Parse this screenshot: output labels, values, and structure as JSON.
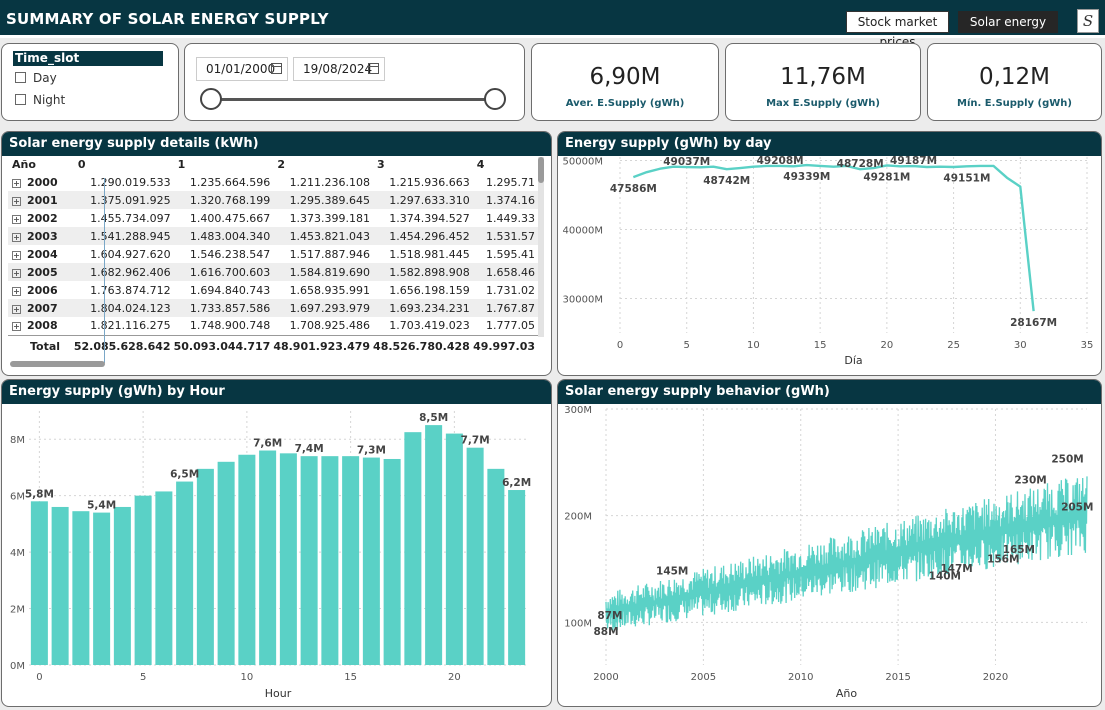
{
  "header": {
    "title": "SUMMARY OF SOLAR ENERGY SUPPLY",
    "nav_stock": "Stock market prices",
    "nav_solar": "Solar energy",
    "logo_glyph": "S"
  },
  "colors": {
    "header_bg": "#073642",
    "bar": "#5ad1c6",
    "line": "#5ad1c6"
  },
  "slicer": {
    "title": "Time_slot",
    "options": [
      "Day",
      "Night"
    ]
  },
  "date_range": {
    "start": "01/01/2000",
    "end": "19/08/2024",
    "slider_low": 0,
    "slider_high": 1
  },
  "kpis": [
    {
      "value": "6,90M",
      "label": "Aver. E.Supply (gWh)"
    },
    {
      "value": "11,76M",
      "label": "Max E.Supply (gWh)"
    },
    {
      "value": "0,12M",
      "label": "Mín. E.Supply (gWh)"
    }
  ],
  "table": {
    "title": "Solar energy supply details (kWh)",
    "columns": [
      "Año",
      "0",
      "1",
      "2",
      "3",
      "4"
    ],
    "rows": [
      [
        "2000",
        "1.290.019.533",
        "1.235.664.596",
        "1.211.236.108",
        "1.215.936.663",
        "1.295.71"
      ],
      [
        "2001",
        "1.375.091.925",
        "1.320.768.199",
        "1.295.389.645",
        "1.297.633.310",
        "1.374.16"
      ],
      [
        "2002",
        "1.455.734.097",
        "1.400.475.667",
        "1.373.399.181",
        "1.374.394.527",
        "1.449.33"
      ],
      [
        "2003",
        "1.541.288.945",
        "1.483.004.340",
        "1.453.821.043",
        "1.454.296.452",
        "1.531.57"
      ],
      [
        "2004",
        "1.604.927.620",
        "1.546.238.547",
        "1.517.887.946",
        "1.518.981.445",
        "1.595.41"
      ],
      [
        "2005",
        "1.682.962.406",
        "1.616.700.603",
        "1.584.819.690",
        "1.582.898.908",
        "1.658.46"
      ],
      [
        "2006",
        "1.763.874.712",
        "1.694.840.743",
        "1.658.935.991",
        "1.656.198.159",
        "1.731.02"
      ],
      [
        "2007",
        "1.804.024.123",
        "1.733.857.586",
        "1.697.293.979",
        "1.693.234.231",
        "1.767.87"
      ],
      [
        "2008",
        "1.821.116.275",
        "1.748.900.748",
        "1.708.925.486",
        "1.703.419.023",
        "1.777.05"
      ]
    ],
    "total": [
      "Total",
      "52.085.628.642",
      "50.093.044.717",
      "48.901.923.479",
      "48.526.780.428",
      "49.997.03"
    ]
  },
  "chart_data": [
    {
      "type": "line",
      "title": "Energy supply (gWh) by day",
      "xlabel": "Día",
      "ylabel": "",
      "xlim": [
        0,
        35
      ],
      "ylim": [
        25000,
        50500
      ],
      "x_ticks": [
        "0",
        "5",
        "10",
        "15",
        "20",
        "25",
        "30",
        "35"
      ],
      "y_ticks": [
        "30000M",
        "40000M",
        "50000M"
      ],
      "x": [
        1,
        2,
        3,
        4,
        5,
        6,
        7,
        8,
        9,
        10,
        11,
        12,
        13,
        14,
        15,
        16,
        17,
        18,
        19,
        20,
        21,
        22,
        23,
        24,
        25,
        26,
        27,
        28,
        29,
        30,
        31
      ],
      "values": [
        47586,
        48300,
        48800,
        49100,
        49037,
        49000,
        49100,
        48742,
        48900,
        49100,
        49200,
        49208,
        49150,
        49339,
        49200,
        49100,
        49200,
        48728,
        48900,
        49281,
        49150,
        49187,
        49050,
        49100,
        49050,
        49151,
        49200,
        49200,
        47500,
        46200,
        28167
      ],
      "labels": [
        {
          "x": 1,
          "y": 47586,
          "text": "47586M"
        },
        {
          "x": 5,
          "y": 49037,
          "text": "49037M"
        },
        {
          "x": 8,
          "y": 48742,
          "text": "48742M"
        },
        {
          "x": 12,
          "y": 49208,
          "text": "49208M"
        },
        {
          "x": 14,
          "y": 49339,
          "text": "49339M"
        },
        {
          "x": 18,
          "y": 48728,
          "text": "48728M"
        },
        {
          "x": 20,
          "y": 49281,
          "text": "49281M"
        },
        {
          "x": 22,
          "y": 49187,
          "text": "49187M"
        },
        {
          "x": 26,
          "y": 49151,
          "text": "49151M"
        },
        {
          "x": 31,
          "y": 28167,
          "text": "28167M"
        }
      ]
    },
    {
      "type": "bar",
      "title": "Energy supply (gWh) by Hour",
      "xlabel": "Hour",
      "ylabel": "",
      "ylim": [
        0,
        9
      ],
      "x_ticks": [
        "0",
        "5",
        "10",
        "15",
        "20"
      ],
      "y_ticks": [
        "0M",
        "2M",
        "4M",
        "6M",
        "8M"
      ],
      "categories": [
        "0",
        "1",
        "2",
        "3",
        "4",
        "5",
        "6",
        "7",
        "8",
        "9",
        "10",
        "11",
        "12",
        "13",
        "14",
        "15",
        "16",
        "17",
        "18",
        "19",
        "20",
        "21",
        "22",
        "23"
      ],
      "values": [
        5.8,
        5.6,
        5.45,
        5.4,
        5.6,
        6.0,
        6.15,
        6.5,
        6.95,
        7.2,
        7.45,
        7.6,
        7.5,
        7.4,
        7.4,
        7.4,
        7.35,
        7.3,
        8.25,
        8.5,
        8.2,
        7.7,
        6.95,
        6.2
      ],
      "data_labels": [
        {
          "index": 0,
          "text": "5,8M"
        },
        {
          "index": 3,
          "text": "5,4M"
        },
        {
          "index": 7,
          "text": "6,5M"
        },
        {
          "index": 11,
          "text": "7,6M"
        },
        {
          "index": 13,
          "text": "7,4M"
        },
        {
          "index": 16,
          "text": "7,3M"
        },
        {
          "index": 19,
          "text": "8,5M"
        },
        {
          "index": 21,
          "text": "7,7M"
        },
        {
          "index": 23,
          "text": "6,2M"
        }
      ]
    },
    {
      "type": "line",
      "title": "Solar energy supply behavior (gWh)",
      "xlabel": "Año",
      "ylabel": "",
      "xlim": [
        2000,
        2024.7
      ],
      "ylim": [
        60,
        300
      ],
      "x_ticks": [
        "2000",
        "2005",
        "2010",
        "2015",
        "2020"
      ],
      "y_ticks": [
        "100M",
        "200M",
        "300M"
      ],
      "trend": {
        "x_start": 2000,
        "low_start": 90,
        "low_end": 165,
        "high_start": 128,
        "high_end": 240
      },
      "labels": [
        {
          "x": 2000.2,
          "y": 103,
          "text": "87M"
        },
        {
          "x": 2000.0,
          "y": 88,
          "text": "88M"
        },
        {
          "x": 2003.4,
          "y": 145,
          "text": "145M"
        },
        {
          "x": 2017.4,
          "y": 140,
          "text": "140M"
        },
        {
          "x": 2018.0,
          "y": 147,
          "text": "147M"
        },
        {
          "x": 2020.4,
          "y": 156,
          "text": "156M"
        },
        {
          "x": 2021.2,
          "y": 165,
          "text": "165M"
        },
        {
          "x": 2021.8,
          "y": 230,
          "text": "230M"
        },
        {
          "x": 2023.7,
          "y": 250,
          "text": "250M"
        },
        {
          "x": 2024.2,
          "y": 205,
          "text": "205M"
        }
      ]
    }
  ]
}
